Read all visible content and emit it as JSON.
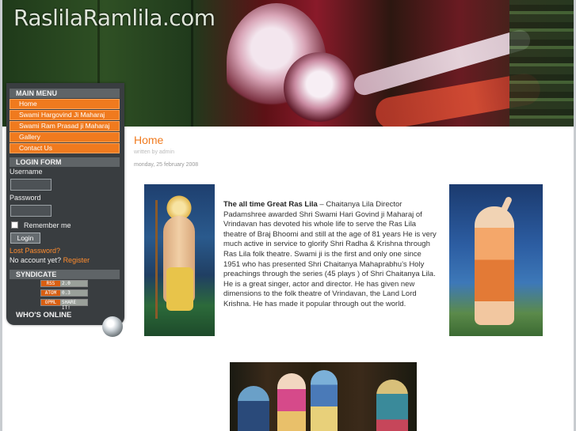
{
  "site": {
    "logo_text": "RaslilaRamlila.com"
  },
  "sidebar": {
    "main_menu": {
      "title": "MAIN MENU",
      "items": [
        {
          "label": "Home"
        },
        {
          "label": "Swami Hargovind Ji Maharaj"
        },
        {
          "label": "Swami Ram Prasad ji Maharaj"
        },
        {
          "label": "Gallery"
        },
        {
          "label": "Contact Us"
        }
      ]
    },
    "login": {
      "title": "LOGIN FORM",
      "username_label": "Username",
      "password_label": "Password",
      "remember_label": "Remember me",
      "login_button": "Login",
      "lost_password": "Lost Password?",
      "no_account": "No account yet?",
      "register": "Register"
    },
    "syndicate": {
      "title": "SYNDICATE",
      "feeds": [
        {
          "left": "RSS",
          "right": "2.0"
        },
        {
          "left": "ATOM",
          "right": "0.3"
        },
        {
          "left": "OPML",
          "right": "SHARE IT!"
        }
      ]
    },
    "whos_online": {
      "title": "WHO'S ONLINE"
    }
  },
  "content": {
    "title": "Home",
    "author_line": "written by admin",
    "date_line": "monday, 25 february 2008",
    "article_lead": "The all time Great Ras Lila",
    "article_body": " – Chaitanya Lila  Director Padamshree awarded Shri Swami Hari Govind ji Maharaj of Vrindavan has devoted his whole life to serve the Ras Lila theatre of Braj Bhoomi and still at the age of 81 years He is very much active in service to glorify Shri Radha & Krishna through Ras Lila folk theatre. Swami ji is the first and only one since 1951 who has presented Shri Chaitanya Mahaprabhu’s Holy preachings through the series (45 plays ) of Shri Chaitanya Lila. He is a great singer, actor and director. He has given new dimensions to the folk theatre of Vrindavan, the Land Lord Krishna. He has made it popular through out the world."
  },
  "colors": {
    "accent": "#f07a1e",
    "sidebar_bg": "#393d40",
    "module_title_bg": "#5f6467"
  }
}
